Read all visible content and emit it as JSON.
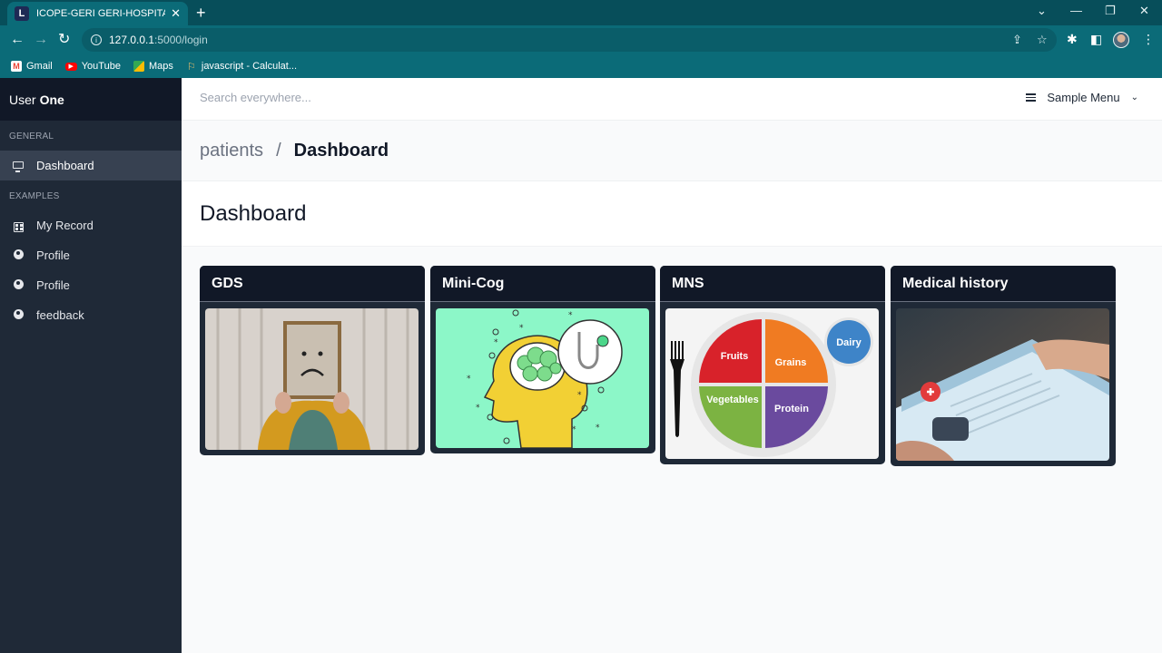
{
  "browser": {
    "tab_title": "ICOPE-GERI GERI-HOSPITAL",
    "tab_favicon": "L",
    "url_host": "127.0.0.1",
    "url_path": ":5000/login",
    "bookmarks": [
      {
        "label": "Gmail",
        "icon": "gmail-icon"
      },
      {
        "label": "YouTube",
        "icon": "youtube-icon"
      },
      {
        "label": "Maps",
        "icon": "maps-icon"
      },
      {
        "label": "javascript - Calculat...",
        "icon": "bookmark-page-icon"
      }
    ]
  },
  "sidebar": {
    "user_first": "User",
    "user_last": "One",
    "section_general": "GENERAL",
    "section_examples": "EXAMPLES",
    "items": [
      {
        "label": "Dashboard",
        "icon": "monitor-icon",
        "active": true
      },
      {
        "label": "My Record",
        "icon": "table-icon"
      },
      {
        "label": "Profile",
        "icon": "user-circle-icon"
      },
      {
        "label": "Profile",
        "icon": "user-circle-icon"
      },
      {
        "label": "feedback",
        "icon": "user-circle-icon"
      }
    ]
  },
  "topbar": {
    "search_placeholder": "Search everywhere...",
    "menu_label": "Sample Menu"
  },
  "breadcrumb": {
    "parent": "patients",
    "separator": "/",
    "current": "Dashboard"
  },
  "page": {
    "title": "Dashboard"
  },
  "cards": [
    {
      "title": "GDS",
      "image": "sad-face-mask-photo"
    },
    {
      "title": "Mini-Cog",
      "image": "brain-head-stethoscope-illustration"
    },
    {
      "title": "MNS",
      "image": "nutrition-plate-diagram",
      "plate_labels": [
        "Fruits",
        "Grains",
        "Vegetables",
        "Protein",
        "Dairy"
      ]
    },
    {
      "title": "Medical history",
      "image": "medical-record-tablet-photo"
    }
  ],
  "colors": {
    "browser_frame": "#0b6b78",
    "sidebar_bg": "#1f2937",
    "sidebar_header_bg": "#111827",
    "card_header_bg": "#111827"
  }
}
